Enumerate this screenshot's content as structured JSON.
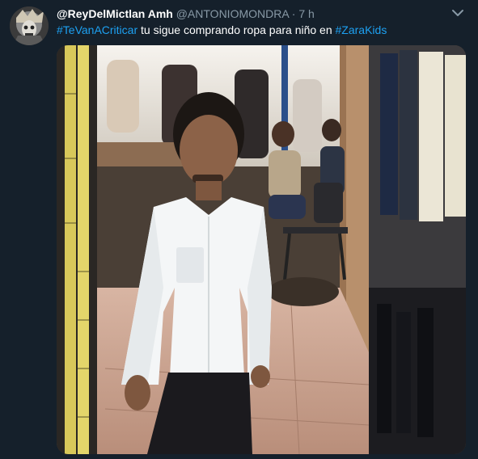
{
  "tweet": {
    "display_name": "@ReyDelMictlan Amh",
    "handle": "@ANTONIOMONDRA",
    "separator": "·",
    "time": "7 h",
    "hashtag_1": "#TeVanACriticar",
    "body": " tu sigue comprando ropa para niño en ",
    "hashtag_2": "#ZaraKids"
  },
  "icons": {
    "avatar": "profile-avatar",
    "menu": "chevron-down-icon"
  },
  "colors": {
    "background": "#15202b",
    "link": "#1da1f2",
    "muted": "#8899a6"
  }
}
